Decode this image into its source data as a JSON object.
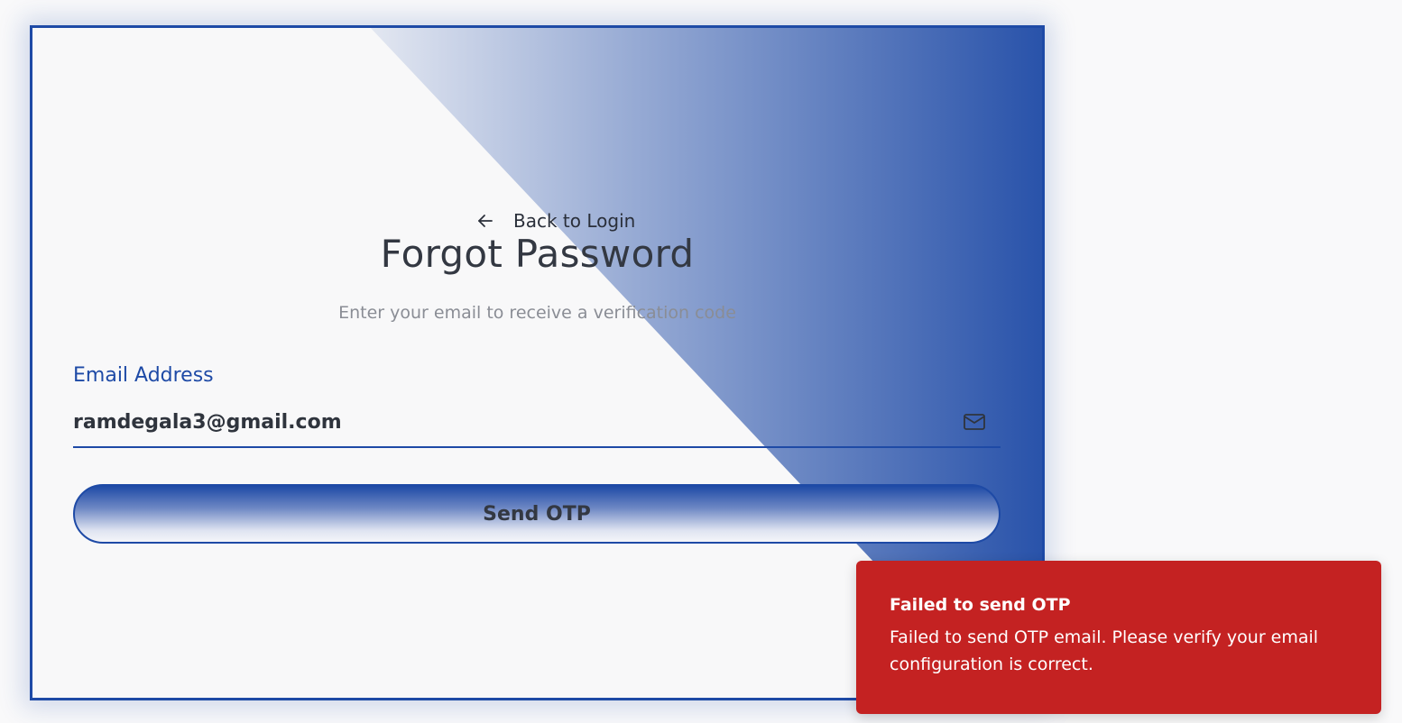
{
  "back_link": {
    "label": "Back to Login",
    "icon": "arrow-left-icon"
  },
  "title": "Forgot Password",
  "subtitle": "Enter your email to receive a verification code",
  "email_field": {
    "label": "Email Address",
    "value": "ramdegala3@gmail.com",
    "icon": "mail-icon"
  },
  "send_button": {
    "label": "Send OTP"
  },
  "toast": {
    "title": "Failed to send OTP",
    "message": "Failed to send OTP email. Please verify your email configuration is correct."
  },
  "colors": {
    "accent": "#1e4aa6",
    "error": "#c42222"
  }
}
